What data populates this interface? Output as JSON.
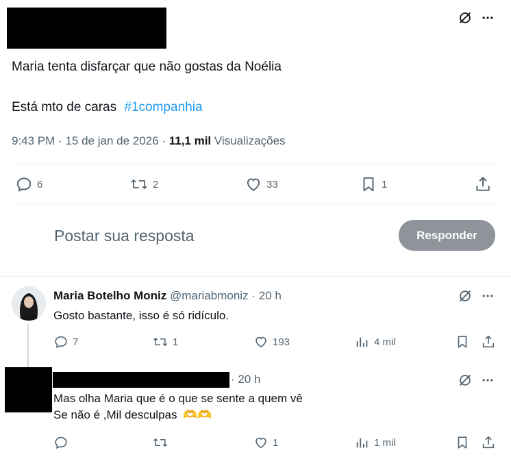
{
  "main_tweet": {
    "text_line1": "Maria tenta disfarçar que não gostas da Noélia",
    "text_line2_prefix": "Está mto de caras",
    "hashtag": "#1companhia",
    "time": "9:43 PM",
    "sep": "·",
    "date": "15 de jan de 2026",
    "views_count": "11,1 mil",
    "views_label": "Visualizações",
    "replies": "6",
    "retweets": "2",
    "likes": "33",
    "bookmarks": "1"
  },
  "composer": {
    "placeholder": "Postar sua resposta",
    "button_label": "Responder"
  },
  "reply1": {
    "name": "Maria Botelho Moniz",
    "handle": "@mariabmoniz",
    "sep": "·",
    "time": "20 h",
    "text": "Gosto bastante, isso é só ridículo.",
    "replies": "7",
    "retweets": "1",
    "likes": "193",
    "views": "4 mil"
  },
  "reply2": {
    "sep": "·",
    "time": "20 h",
    "text_line1": "Mas olha Maria que é o que se sente a quem vê",
    "text_line2": "Se não é ,Mil desculpas",
    "emoji": "🫶🫶",
    "likes": "1",
    "views": "1 mil"
  },
  "icons": [
    "grok-icon",
    "more-icon",
    "reply-icon",
    "retweet-icon",
    "like-icon",
    "views-icon",
    "bookmark-icon",
    "share-icon"
  ],
  "colors": {
    "link": "#1d9bf0",
    "secondary": "#536471",
    "button_disabled": "#8e9499",
    "divider": "#eff3f4"
  }
}
